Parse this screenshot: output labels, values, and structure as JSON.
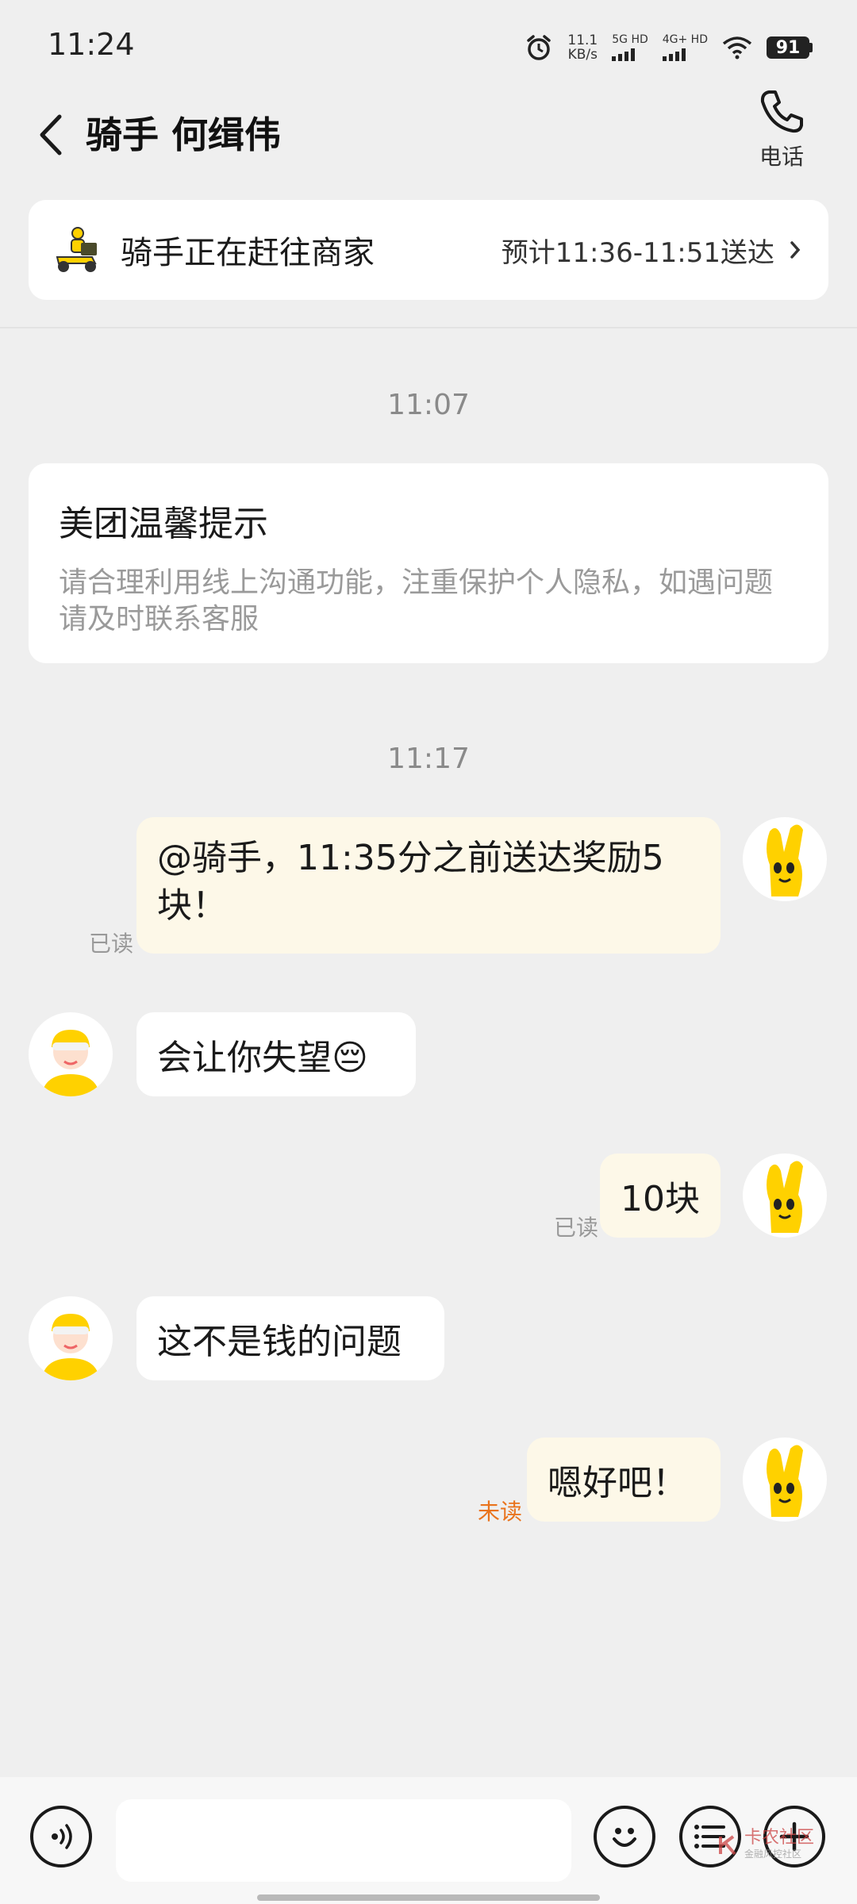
{
  "status_bar": {
    "time": "11:24",
    "speed_value": "11.1",
    "speed_unit": "KB/s",
    "net1": "5G HD",
    "net2": "4G+ HD",
    "battery": "91"
  },
  "header": {
    "title": "骑手 何缉伟",
    "phone_label": "电话",
    "icons": [
      "back-chevron-icon",
      "phone-icon"
    ]
  },
  "delivery": {
    "status": "骑手正在赶往商家",
    "eta": "预计11:36-11:51送达"
  },
  "timestamps": [
    "11:07",
    "11:17"
  ],
  "notice": {
    "title": "美团温馨提示",
    "body": "请合理利用线上沟通功能，注重保护个人隐私，如遇问题请及时联系客服"
  },
  "messages": [
    {
      "sender": "me",
      "text": "@骑手，11:35分之前送达奖励5块！",
      "status": "已读"
    },
    {
      "sender": "rider",
      "text": "会让你失望😔"
    },
    {
      "sender": "me",
      "text": "10块",
      "status": "已读"
    },
    {
      "sender": "rider",
      "text": "这不是钱的问题"
    },
    {
      "sender": "me",
      "text": "嗯好吧！",
      "status": "未读"
    }
  ],
  "input_bar": {
    "placeholder": "",
    "icons": [
      "voice-icon",
      "emoji-icon",
      "quick-reply-icon",
      "plus-icon"
    ]
  },
  "watermark": {
    "text": "卡农社区",
    "sub": "金融风控社区"
  },
  "colors": {
    "background": "#efefef",
    "outgoing_bubble": "#fdf8e8",
    "unread": "#e9731c",
    "brand_yellow": "#ffd100"
  }
}
